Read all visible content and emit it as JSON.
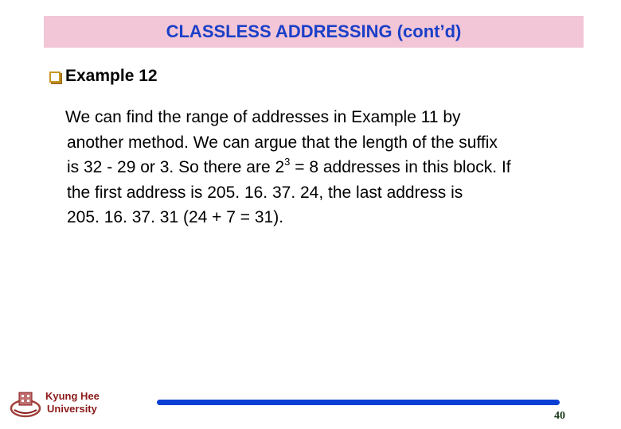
{
  "slide": {
    "title": "CLASSLESS ADDRESSING (cont’d)",
    "bullet": {
      "icon": "checkbox-square-icon",
      "label": "Example 12"
    },
    "body_lines": {
      "line1": "We can find the range of addresses in Example 11 by",
      "line2": "another method. We can argue that the length of the suffix",
      "line3_pre": "is 32 - 29 or 3. So there are 2",
      "line3_sup": "3",
      "line3_post": " = 8 addresses in this block. If",
      "line4": "the first address is 205. 16. 37. 24, the last address is",
      "line5": "205. 16. 37. 31 (24 + 7 = 31)."
    }
  },
  "footer": {
    "logo_icon": "university-emblem-icon",
    "university_line1": "Kyung Hee",
    "university_line2": "University",
    "page_number": "40"
  },
  "colors": {
    "title_background": "#f2c6d6",
    "title_text": "#1a3fc8",
    "footer_bar": "#0a3fd4",
    "university_text": "#8b1a1a"
  }
}
